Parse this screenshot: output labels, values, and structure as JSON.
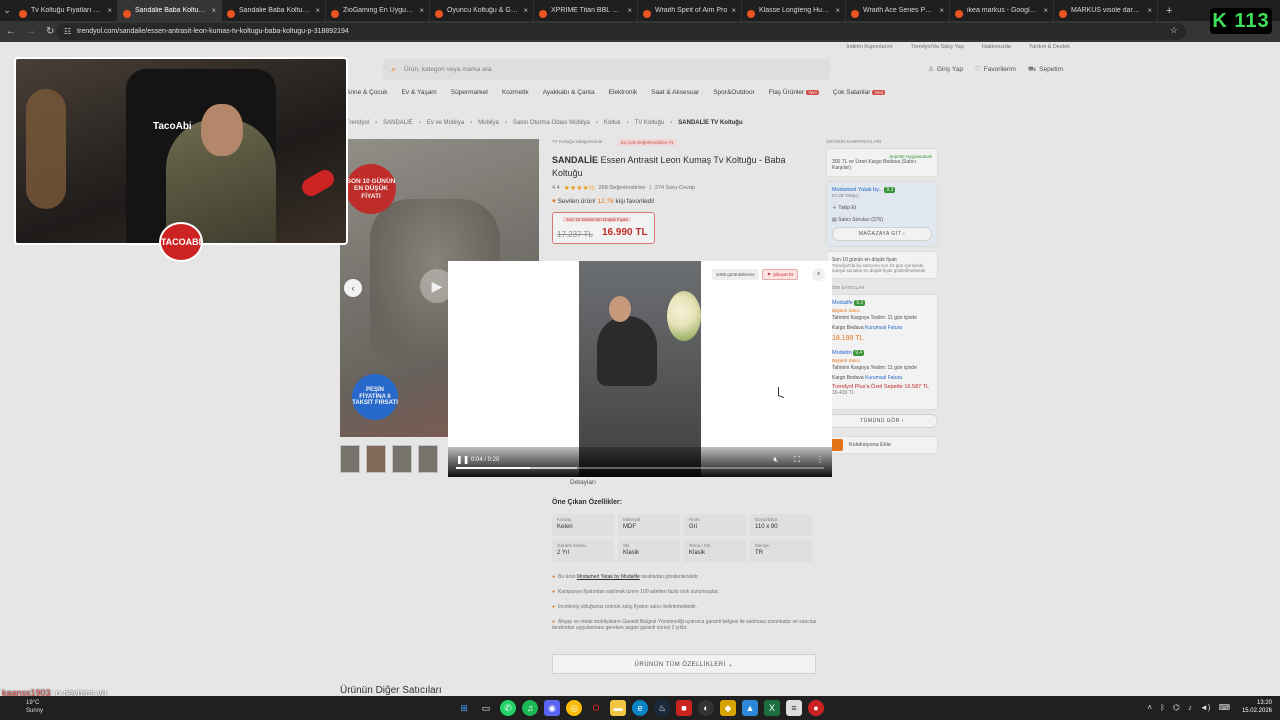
{
  "browser": {
    "tabs": [
      {
        "label": "Tv Koltuğu Fiyatları & Bab",
        "active": false
      },
      {
        "label": "Sandalie Baba Koltuğu TV",
        "active": true
      },
      {
        "label": "Sandalie Baba Koltuğu TV",
        "active": false
      },
      {
        "label": "ZioGaming En Uygun Oy",
        "active": false
      },
      {
        "label": "Oyuncu Koltuğu & Game",
        "active": false
      },
      {
        "label": "XPRIME Titan BBL Edition",
        "active": false
      },
      {
        "label": "Wraith Spirit of Aim Pro",
        "active": false
      },
      {
        "label": "Klasse Longteng Huoyun",
        "active": false
      },
      {
        "label": "Wraith Ace Series Porsch",
        "active": false
      },
      {
        "label": "ikea markus - Google'da A",
        "active": false
      },
      {
        "label": "MARKUS visole dark grey",
        "active": false
      }
    ],
    "url": "trendyol.com/sandalie/essen-antrasit-leon-kumas-tv-koltugu-baba-koltugu-p-318892194"
  },
  "header": {
    "toplinks": [
      "İndirim Kuponlarım",
      "Trendyol'da Satış Yap",
      "Hakkımızda",
      "Yardım & Destek"
    ],
    "search_placeholder": "Ürün, kategori veya marka ara",
    "user_actions": [
      "Giriş Yap",
      "Favorilerim",
      "Sepetim"
    ],
    "categories": [
      {
        "label": "Anne & Çocuk",
        "badge": ""
      },
      {
        "label": "Ev & Yaşam",
        "badge": ""
      },
      {
        "label": "Süpermarket",
        "badge": ""
      },
      {
        "label": "Kozmetik",
        "badge": ""
      },
      {
        "label": "Ayakkabı & Çanta",
        "badge": ""
      },
      {
        "label": "Elektronik",
        "badge": ""
      },
      {
        "label": "Saat & Aksesuar",
        "badge": ""
      },
      {
        "label": "Spor&Outdoor",
        "badge": ""
      },
      {
        "label": "Flaş Ürünler",
        "badge": "Yeni"
      },
      {
        "label": "Çok Satanlar",
        "badge": "Yeni"
      }
    ]
  },
  "breadcrumbs": [
    "Trendyol",
    "SANDALİE",
    "Ev ve Mobilya",
    "Mobilya",
    "Salon Oturma Odası Mobilya",
    "Koltuk",
    "TV Koltuğu",
    "SANDALİE TV Koltuğu"
  ],
  "product": {
    "image_badge_red": "SON 10 GÜNÜN EN DÜŞÜK FİYATI",
    "image_badge_blue": "PEŞİN FİYATINA 6 TAKSİT FIRSATI",
    "category_rank": "TV Koltuğu kategorisinde",
    "rank_badge": "En Çok Değerlendirilen #1",
    "brand": "SANDALİE",
    "title": "Essen Antrasit Leon Kumaş Tv Koltuğu - Baba Koltuğu",
    "rating": "4.4",
    "stars": "★★★★½",
    "reviews": "268 Değerlendirme",
    "qa": "274 Soru-Cevap",
    "fav_prefix": "Sevilen ürün!",
    "fav_count": "12,78",
    "fav_suffix": "kişi favoriledi!",
    "price_label": "Son 10 Günün En Düşük Fiyatı",
    "old_price": "17.237 TL",
    "new_price": "16.990 TL",
    "details_tab": "Detayları",
    "features_heading": "Öne Çıkan Özellikler:",
    "features": [
      {
        "k": "Kumaş",
        "v": "Keten"
      },
      {
        "k": "Materyal",
        "v": "MDF"
      },
      {
        "k": "Renk",
        "v": "Gri"
      },
      {
        "k": "Boyut/Ebat",
        "v": "110 x 90"
      },
      {
        "k": "Garanti Süresi",
        "v": "2 Yıl"
      },
      {
        "k": "Stil",
        "v": "Klasik"
      },
      {
        "k": "Tema / Stil",
        "v": "Klasik"
      },
      {
        "k": "Menşei",
        "v": "TR"
      }
    ],
    "bullets": [
      {
        "pre": "Bu ürün",
        "link": "Modamed Yatak by Modalife",
        "post": "tarafından gönderilecektir."
      },
      {
        "pre": "Kampanya fiyatından satılmak üzere 100 adetten fazla stok sunulmuştur.",
        "link": "",
        "post": ""
      },
      {
        "pre": "İncelemiş olduğunuz ürünün satış fiyatını satıcı belirlemektedir.",
        "link": "",
        "post": ""
      },
      {
        "pre": "Ahşap ve metal mobilyaların Garanti Belgesi Yönetmeliği uyarınca garanti belgesi ile satılması zorunludur ve satıcılar tarafından uygulanması gereken asgari garanti süresi 2 yıldır.",
        "link": "",
        "post": ""
      }
    ],
    "all_features_btn": "ÜRÜNÜN TÜM ÖZELLİKLERİ ⌄",
    "other_sellers": "Ürünün Diğer Satıcıları"
  },
  "sidebar": {
    "campaigns_label": "ÜRÜNÜN KAMPANYALARI",
    "campaign": "300 TL ve Üzeri Kargo Bedava (Satıcı Karşılar)",
    "campaign_tag": "Sepette Uygulanacak",
    "seller_name": "Modamed Yatak by...",
    "seller_score": "9.3",
    "seller_followers": "57,2B Takipçi",
    "follow": "Takip Et",
    "questions": "Satıcı Soruları (276)",
    "store_btn": "MAĞAZAYA GİT ›",
    "lowest_price_note": "Son 10 günün en düşük fiyatı",
    "lowest_price_sub": "Trendyol'da bu satıcının son 10 gün içerisinde satışta sunulan en düşük fiyatı gösterilmektedir.",
    "other_sellers_label": "DİĞER SATICILAR",
    "offers": [
      {
        "seller": "Modalife",
        "score": "9.3",
        "tag": "Başarılı Satıcı",
        "eta": "Tahmini Kargoya Teslim: 11 gün içinde",
        "ship": "Kargo Bedava",
        "inv": "Kurumsal Fatura",
        "price": "18.199 TL",
        "plus": ""
      },
      {
        "seller": "Modetto",
        "score": "9.4",
        "tag": "Başarılı Satıcı",
        "eta": "Tahmini Kargoya Teslim: 11 gün içinde",
        "ship": "Kargo Bedava",
        "inv": "Kurumsal Fatura",
        "price": "16.587 TL",
        "plus": "Trendyol Plus'a Özel Sepette 16.587 TL",
        "old": "16.433 TL"
      }
    ],
    "all_btn": "TÜMÜNÜ GÖR ›",
    "collection": "Koleksiyona Ekle"
  },
  "video": {
    "views": "3408 görüntülenme",
    "report": "Şikayet Et",
    "time": "0:04 / 0:20",
    "progress": 0.2,
    "buffered": 0.33
  },
  "stream": {
    "streamer_name": "TacoAbi",
    "logo_text": "TACOABI",
    "counter": "K 113",
    "chat": [
      {
        "user": "kaanss1903",
        "msg": "o neymuş ya"
      },
      {
        "user": "kaanss1903",
        "msg": ""
      }
    ]
  },
  "taskbar": {
    "weather_temp": "19°C",
    "weather_desc": "Sunny",
    "time": "13:20",
    "date": "15.02.2026"
  },
  "colors": {
    "accent": "#f27a1a",
    "price_red": "#c9302c",
    "seller_blue": "#2a6fd6",
    "score_green": "#3c9d3a",
    "counter_green": "#3fe05c"
  }
}
